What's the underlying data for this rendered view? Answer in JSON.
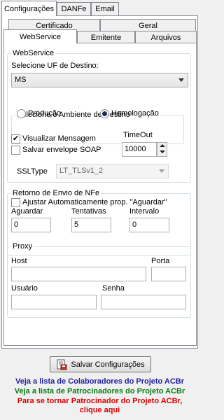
{
  "tabs": [
    "Configurações",
    "DANFe",
    "Email"
  ],
  "subtabs_row1": [
    "Certificado",
    "Geral"
  ],
  "subtabs_row2": [
    "WebService",
    "Emitente",
    "Arquivos"
  ],
  "webservice": {
    "legend": "WebService",
    "uf_label": "Selecione UF de Destino:",
    "uf_value": "MS",
    "ambiente_legend": "Selecione o Ambiente de Destino",
    "producao_label": "Produção",
    "producao_checked": false,
    "homologacao_label": "Homologação",
    "homologacao_checked": true,
    "visualizar_label": "Visualizar Mensagem",
    "visualizar_checked": true,
    "salvar_envelope_label": "Salvar envelope SOAP",
    "salvar_envelope_checked": false,
    "timeout_label": "TimeOut",
    "timeout_value": "10000",
    "ssltype_label": "SSLType",
    "ssltype_value": "LT_TLSv1_2"
  },
  "retorno": {
    "legend": "Retorno de Envio de NFe",
    "ajustar_label": "Ajustar Automaticamente prop. \"Aguardar\"",
    "ajustar_checked": false,
    "aguardar_label": "Aguardar",
    "aguardar_value": "0",
    "tentativas_label": "Tentativas",
    "tentativas_value": "5",
    "intervalo_label": "Intervalo",
    "intervalo_value": "0"
  },
  "proxy": {
    "legend": "Proxy",
    "host_label": "Host",
    "host_value": "",
    "porta_label": "Porta",
    "porta_value": "",
    "usuario_label": "Usuário",
    "usuario_value": "",
    "senha_label": "Senha",
    "senha_value": ""
  },
  "save_button": "Salvar Configurações",
  "links": {
    "colaboradores": "Veja a lista de Colaboradores do Projeto ACBr",
    "patrocinadores": "Veja a lista de Patrocinadores do Projeto ACBr",
    "patrocinador_line1": "Para se tornar Patrocinador do Projeto ACBr,",
    "patrocinador_line2": "clique aqui"
  },
  "colors": {
    "link_blue": "#1f1f9c",
    "link_green": "#0b7a12",
    "link_red": "#e00000"
  }
}
